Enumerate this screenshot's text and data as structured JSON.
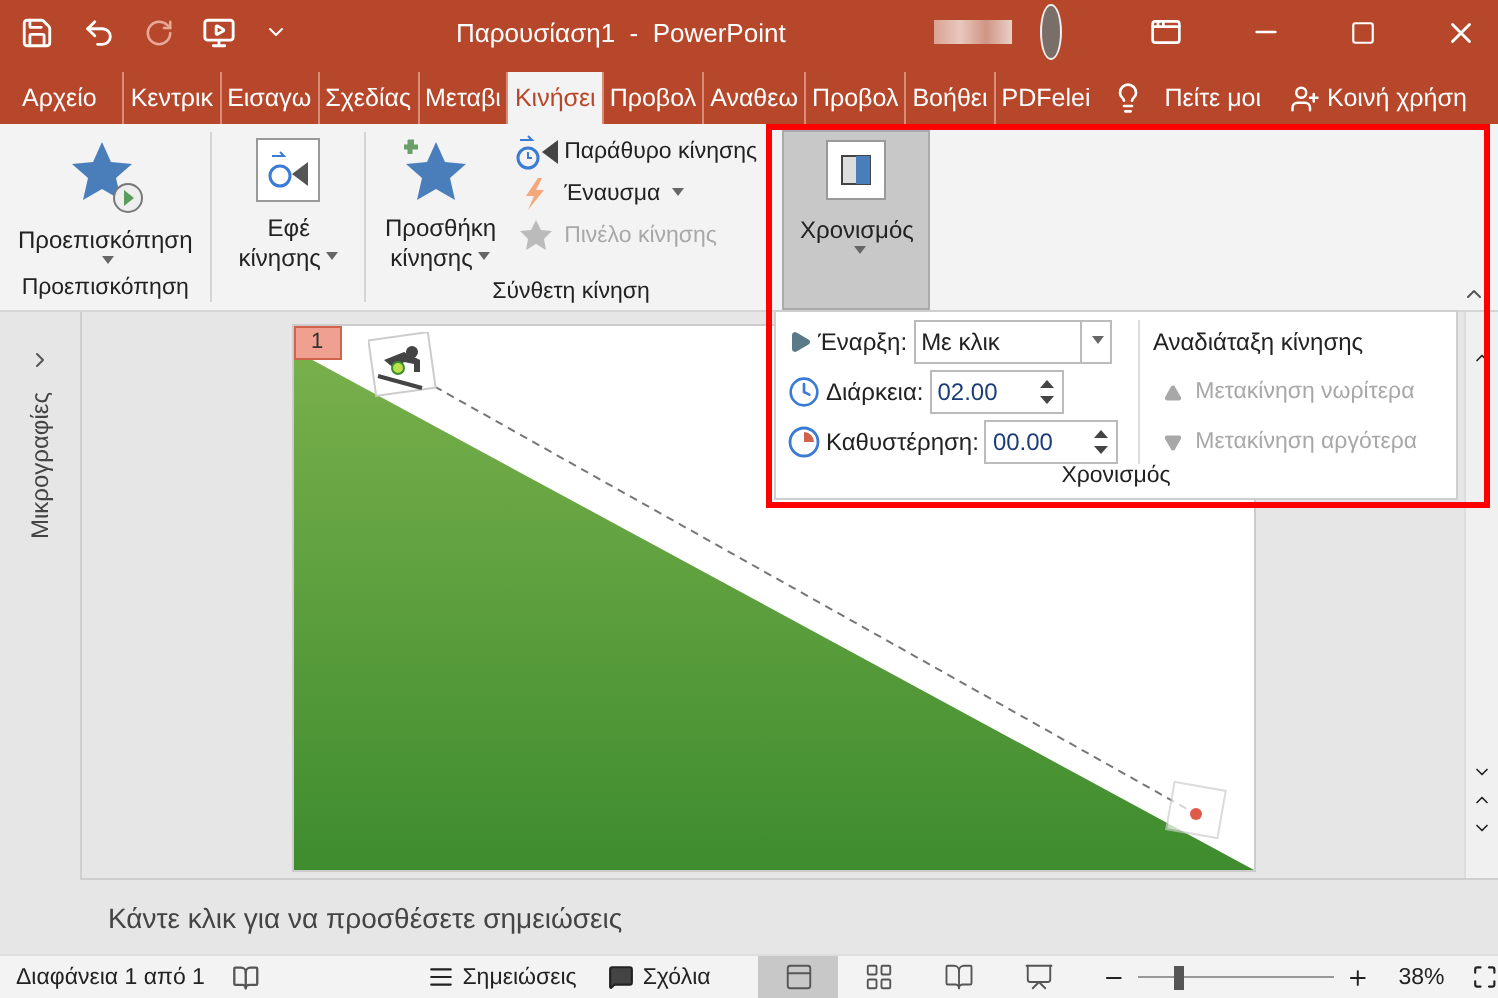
{
  "title_bar": {
    "title": "Παρουσίαση1  -  PowerPoint"
  },
  "tabs": [
    {
      "label": "Αρχείο",
      "selected": false
    },
    {
      "label": "Κεντρικ",
      "selected": false
    },
    {
      "label": "Εισαγω",
      "selected": false
    },
    {
      "label": "Σχεδίας",
      "selected": false
    },
    {
      "label": "Μεταβι",
      "selected": false
    },
    {
      "label": "Κινήσει",
      "selected": true
    },
    {
      "label": "Προβολ",
      "selected": false
    },
    {
      "label": "Αναθεω",
      "selected": false
    },
    {
      "label": "Προβολ",
      "selected": false
    },
    {
      "label": "Βοήθει",
      "selected": false
    },
    {
      "label": "PDFelei",
      "selected": false
    }
  ],
  "tell_me": "Πείτε μοι",
  "share": "Κοινή χρήση",
  "ribbon": {
    "preview": {
      "button": "Προεπισκόπηση",
      "group_label": "Προεπισκόπηση"
    },
    "effects": {
      "lines": [
        "Εφέ",
        "κίνησης"
      ]
    },
    "advanced": {
      "add_lines": [
        "Προσθήκη",
        "κίνησης"
      ],
      "group_label": "Σύνθετη κίνηση",
      "items": [
        {
          "kind": "pane",
          "label": "Παράθυρο κίνησης",
          "dropdown": false,
          "disabled": false
        },
        {
          "kind": "trigger",
          "label": "Έναυσμα",
          "dropdown": true,
          "disabled": false
        },
        {
          "kind": "painter",
          "label": "Πινέλο κίνησης",
          "dropdown": false,
          "disabled": true
        }
      ]
    },
    "timing": {
      "button": "Χρονισμός",
      "expanded": true
    }
  },
  "timing_panel": {
    "start_label": "Έναρξη:",
    "start_value": "Με κλικ",
    "duration_label": "Διάρκεια:",
    "duration_value": "02.00",
    "delay_label": "Καθυστέρηση:",
    "delay_value": "00.00",
    "reorder_title": "Αναδιάταξη κίνησης",
    "moves": [
      {
        "kind": "up",
        "label": "Μετακίνηση νωρίτερα",
        "disabled": true
      },
      {
        "kind": "down",
        "label": "Μετακίνηση αργότερα",
        "disabled": true
      }
    ],
    "group_label": "Χρονισμός"
  },
  "thumbnails_label": "Μικρογραφίες",
  "slide": {
    "badge": "1"
  },
  "notes_placeholder": "Κάντε κλικ για να προσθέσετε σημειώσεις",
  "status_bar": {
    "slide_info": "Διαφάνεια 1 από 1",
    "notes": "Σημειώσεις",
    "comments": "Σχόλια",
    "views": [
      {
        "kind": "normal",
        "selected": true
      },
      {
        "kind": "sorter",
        "selected": false
      },
      {
        "kind": "reading",
        "selected": false
      },
      {
        "kind": "show",
        "selected": false
      }
    ],
    "zoom": {
      "level": 0.18
    },
    "zoom_reading": "38%"
  }
}
